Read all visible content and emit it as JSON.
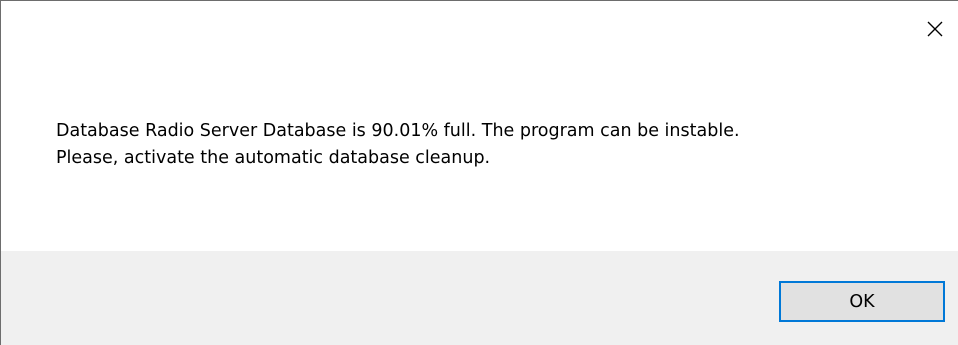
{
  "dialog": {
    "message_lines": [
      "Database Radio Server Database is 90.01% full. The program can be instable.",
      "Please, activate the automatic database cleanup."
    ],
    "ok_label": "OK"
  },
  "icons": {
    "close": "close-icon"
  },
  "colors": {
    "button_focus_border": "#0078d7",
    "button_face": "#e1e1e1",
    "footer_background": "#f0f0f0",
    "window_border": "#6d6d6d"
  }
}
